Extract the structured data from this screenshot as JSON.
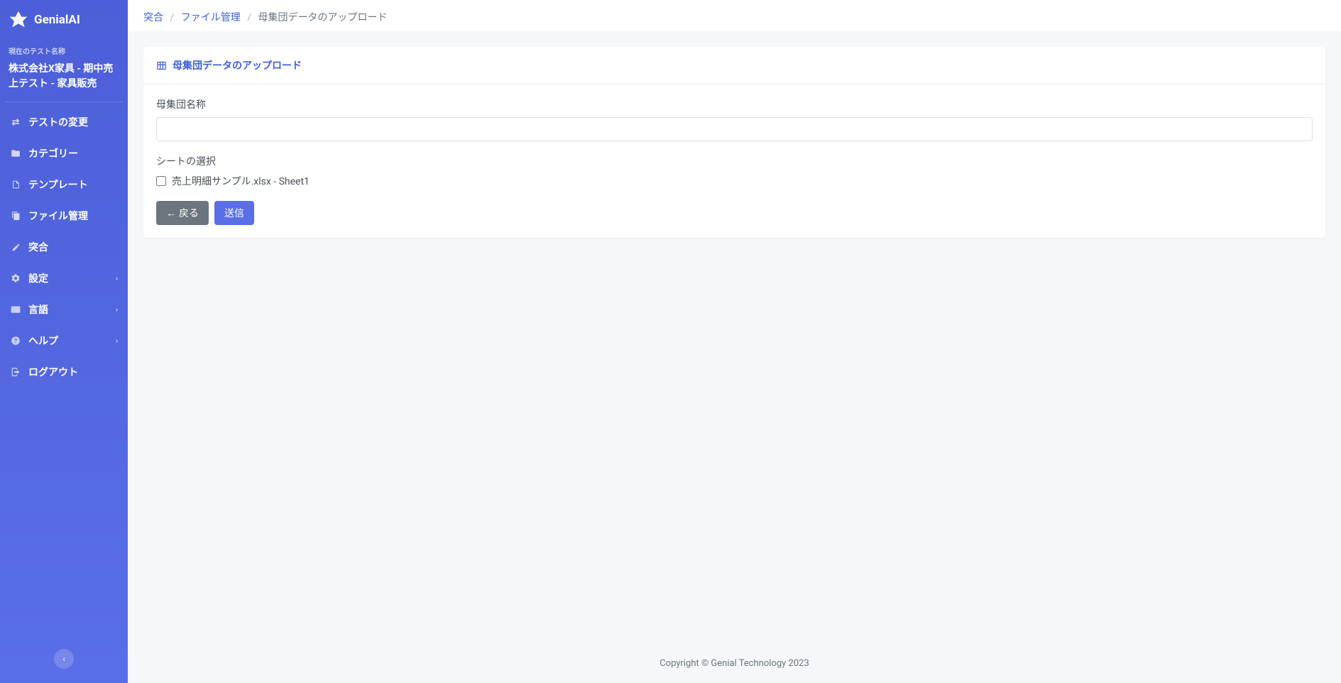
{
  "brand": {
    "name": "GenialAI"
  },
  "sidebar": {
    "current_test_label": "現在のテスト名称",
    "current_test_name": "株式会社X家具 - 期中売上テスト - 家具販売",
    "items": {
      "change_test": "テストの変更",
      "category": "カテゴリー",
      "template": "テンプレート",
      "file_mgmt": "ファイル管理",
      "vouching": "突合",
      "settings": "設定",
      "language": "言語",
      "help": "ヘルプ",
      "logout": "ログアウト"
    }
  },
  "breadcrumb": {
    "item1": "突合",
    "item2": "ファイル管理",
    "current": "母集団データのアップロード"
  },
  "card": {
    "title": "母集団データのアップロード",
    "population_name_label": "母集団名称",
    "population_name_value": "",
    "sheet_select_label": "シートの選択",
    "sheet_option1": "売上明細サンプル.xlsx - Sheet1",
    "back_button": "戻る",
    "submit_button": "送信"
  },
  "footer": {
    "text": "Copyright © Genial Technology 2023"
  }
}
